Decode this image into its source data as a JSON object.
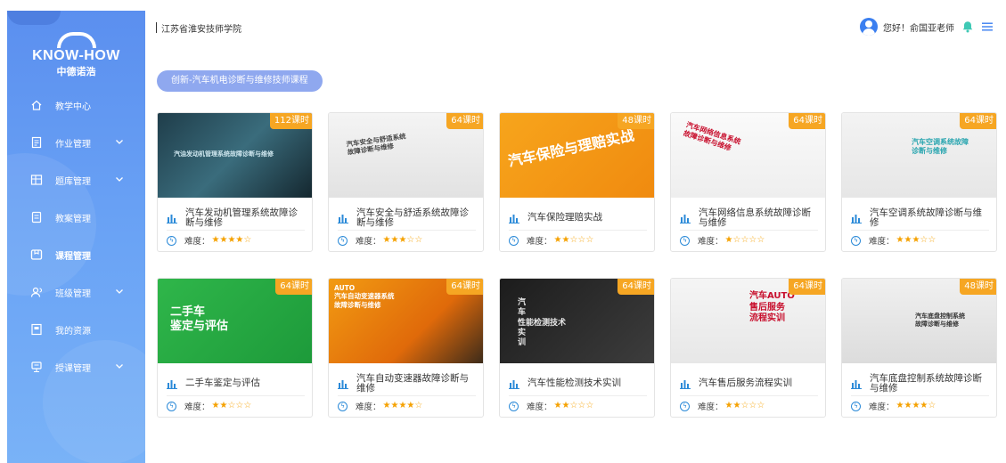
{
  "sidebar": {
    "logo_brand": "KNOW-HOW",
    "logo_sub": "中德诺浩",
    "items": [
      {
        "label": "教学中心",
        "icon": "home-icon",
        "expandable": false,
        "active": false
      },
      {
        "label": "作业管理",
        "icon": "homework-icon",
        "expandable": true,
        "active": false
      },
      {
        "label": "题库管理",
        "icon": "question-bank-icon",
        "expandable": true,
        "active": false
      },
      {
        "label": "教案管理",
        "icon": "lesson-plan-icon",
        "expandable": false,
        "active": false
      },
      {
        "label": "课程管理",
        "icon": "course-icon",
        "expandable": false,
        "active": true
      },
      {
        "label": "班级管理",
        "icon": "class-icon",
        "expandable": true,
        "active": false
      },
      {
        "label": "我的资源",
        "icon": "resource-icon",
        "expandable": false,
        "active": false
      },
      {
        "label": "授课管理",
        "icon": "teaching-icon",
        "expandable": true,
        "active": false
      }
    ]
  },
  "header": {
    "school": "江苏省淮安技师学院",
    "greeting": "您好！俞国亚老师"
  },
  "main": {
    "course_tag": "创新-汽车机电诊断与维修技师课程",
    "difficulty_label": "难度：",
    "cards": [
      {
        "title": "汽车发动机管理系统故障诊断与维修",
        "hours": "112课时",
        "stars": 4,
        "thumb_text": "汽油发动机管理系统故障诊断与维修"
      },
      {
        "title": "汽车安全与舒适系统故障诊断与维修",
        "hours": "64课时",
        "stars": 3,
        "thumb_text": "汽车安全与舒适系统 故障诊断与维修"
      },
      {
        "title": "汽车保险理赔实战",
        "hours": "48课时",
        "stars": 2,
        "thumb_text": "汽车保险与理赔实战"
      },
      {
        "title": "汽车网络信息系统故障诊断与维修",
        "hours": "64课时",
        "stars": 1,
        "thumb_text": "汽车网络信息系统 故障诊断与维修"
      },
      {
        "title": "汽车空调系统故障诊断与维修",
        "hours": "64课时",
        "stars": 3,
        "thumb_text": "汽车空调系统故障 诊断与维修"
      },
      {
        "title": "二手车鉴定与评估",
        "hours": "64课时",
        "stars": 2,
        "thumb_text": "二手车 鉴定与评估"
      },
      {
        "title": "汽车自动变速器故障诊断与维修",
        "hours": "64课时",
        "stars": 4,
        "thumb_text": "AUTO 汽车自动变速器系统 故障诊断与维修"
      },
      {
        "title": "汽车性能检测技术实训",
        "hours": "64课时",
        "stars": 2,
        "thumb_text": "汽 车 性能检测技术 实 训"
      },
      {
        "title": "汽车售后服务流程实训",
        "hours": "64课时",
        "stars": 2,
        "thumb_text": "汽车AUTO 售后服务 流程实训"
      },
      {
        "title": "汽车底盘控制系统故障诊断与维修",
        "hours": "48课时",
        "stars": 4,
        "thumb_text": "汽车底盘控制系统 故障诊断与维修"
      }
    ]
  },
  "colors": {
    "sidebar_top": "#5b8fef",
    "badge": "#f6a623",
    "star": "#f5a100",
    "tag": "#8fa8ef",
    "accent_blue": "#2b8ad8"
  }
}
